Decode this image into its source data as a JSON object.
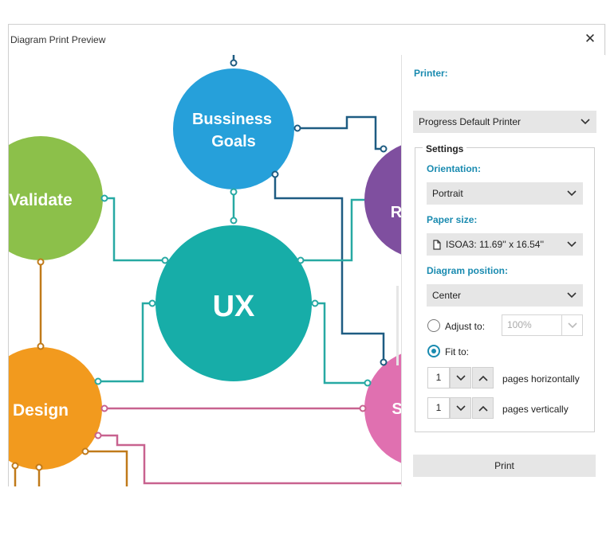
{
  "dialog": {
    "title": "Diagram Print Preview",
    "close_glyph": "✕"
  },
  "diagram": {
    "nodes": {
      "goals_line1": "Bussiness",
      "goals_line2": "Goals",
      "ux": "UX",
      "validate": "Validate",
      "design": "Design",
      "research_partial": "R",
      "support_partial": "S"
    },
    "colors": {
      "goals": "#26a0da",
      "ux": "#17ada8",
      "validate": "#8cc04a",
      "design": "#f29a1e",
      "research": "#7f4f9f",
      "support": "#e070b0",
      "link_teal": "#27a9a3",
      "link_navy": "#1e5c82",
      "link_brown": "#c07a1a",
      "link_pink": "#c8628f"
    }
  },
  "panel": {
    "printer_label": "Printer:",
    "printer_value": "Progress Default Printer",
    "settings_title": "Settings",
    "orientation_label": "Orientation:",
    "orientation_value": "Portrait",
    "paper_label": "Paper size:",
    "paper_value": "ISOA3: 11.69'' x 16.54''",
    "position_label": "Diagram position:",
    "position_value": "Center",
    "adjust_label": "Adjust to:",
    "adjust_value": "100%",
    "fit_label": "Fit to:",
    "pages_h_value": "1",
    "pages_h_label": "pages horizontally",
    "pages_v_value": "1",
    "pages_v_label": "pages vertically",
    "print_button": "Print",
    "selected_scaling": "fit"
  },
  "icons": [
    "close-icon",
    "chevron-down-icon",
    "chevron-up-icon",
    "document-icon",
    "radio-icon"
  ]
}
